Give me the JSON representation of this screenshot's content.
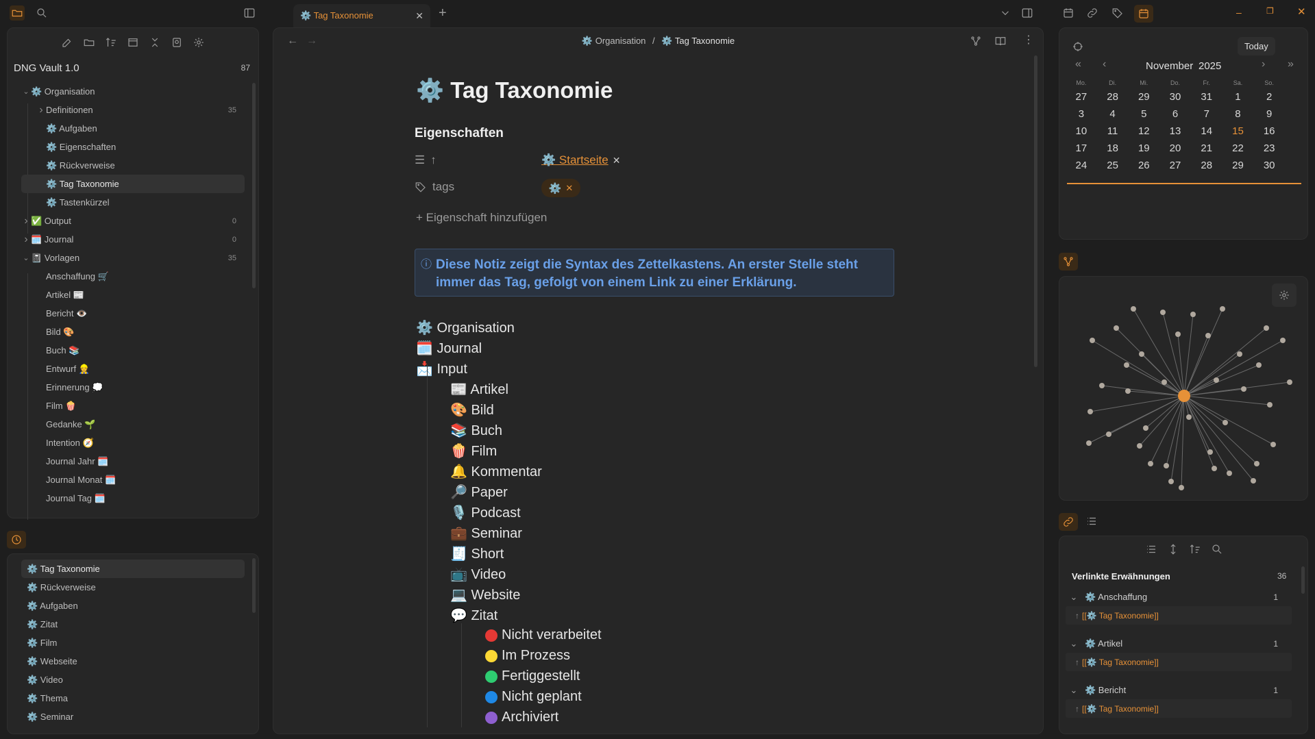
{
  "tab": {
    "title": "⚙️ Tag Taxonomie"
  },
  "breadcrumb": {
    "parent": "⚙️ Organisation",
    "sep": "/",
    "current": "⚙️ Tag Taxonomie"
  },
  "vault": {
    "name": "DNG Vault 1.0",
    "count": "87"
  },
  "tree": [
    {
      "label": "⚙️ Organisation",
      "level": 0,
      "chev": "v",
      "count": ""
    },
    {
      "label": "Definitionen",
      "level": 1,
      "chev": ">",
      "count": "35"
    },
    {
      "label": "⚙️ Aufgaben",
      "level": 1,
      "chev": "",
      "count": ""
    },
    {
      "label": "⚙️ Eigenschaften",
      "level": 1,
      "chev": "",
      "count": ""
    },
    {
      "label": "⚙️ Rückverweise",
      "level": 1,
      "chev": "",
      "count": ""
    },
    {
      "label": "⚙️ Tag Taxonomie",
      "level": 1,
      "chev": "",
      "count": "",
      "active": true
    },
    {
      "label": "⚙️ Tastenkürzel",
      "level": 1,
      "chev": "",
      "count": ""
    },
    {
      "label": "✅ Output",
      "level": 0,
      "chev": ">",
      "count": "0"
    },
    {
      "label": "🗓️ Journal",
      "level": 0,
      "chev": ">",
      "count": "0"
    },
    {
      "label": "📓 Vorlagen",
      "level": 0,
      "chev": "v",
      "count": "35"
    },
    {
      "label": "Anschaffung 🛒",
      "level": 1,
      "chev": "",
      "count": ""
    },
    {
      "label": "Artikel 📰",
      "level": 1,
      "chev": "",
      "count": ""
    },
    {
      "label": "Bericht 👁️",
      "level": 1,
      "chev": "",
      "count": ""
    },
    {
      "label": "Bild 🎨",
      "level": 1,
      "chev": "",
      "count": ""
    },
    {
      "label": "Buch 📚",
      "level": 1,
      "chev": "",
      "count": ""
    },
    {
      "label": "Entwurf 👷",
      "level": 1,
      "chev": "",
      "count": ""
    },
    {
      "label": "Erinnerung 💭",
      "level": 1,
      "chev": "",
      "count": ""
    },
    {
      "label": "Film 🍿",
      "level": 1,
      "chev": "",
      "count": ""
    },
    {
      "label": "Gedanke 🌱",
      "level": 1,
      "chev": "",
      "count": ""
    },
    {
      "label": "Intention 🧭",
      "level": 1,
      "chev": "",
      "count": ""
    },
    {
      "label": "Journal Jahr 🗓️",
      "level": 1,
      "chev": "",
      "count": ""
    },
    {
      "label": "Journal Monat 🗓️",
      "level": 1,
      "chev": "",
      "count": ""
    },
    {
      "label": "Journal Tag 🗓️",
      "level": 1,
      "chev": "",
      "count": ""
    }
  ],
  "recent": [
    "⚙️ Tag Taxonomie",
    "⚙️ Rückverweise",
    "⚙️ Aufgaben",
    "⚙️ Zitat",
    "⚙️ Film",
    "⚙️ Webseite",
    "⚙️ Video",
    "⚙️ Thema",
    "⚙️ Seminar"
  ],
  "note": {
    "title": "⚙️ Tag Taxonomie",
    "props_heading": "Eigenschaften",
    "prop_up_key": "↑",
    "prop_up_value": "⚙️ Startseite",
    "prop_tags_key": "tags",
    "prop_tags_value": "⚙️",
    "add_prop": "+ Eigenschaft hinzufügen",
    "callout": "Diese Notiz zeigt die Syntax des Zettelkastens. An erster Stelle steht immer das Tag, gefolgt von einem Link zu einer Erklärung.",
    "list0": [
      "⚙️ Organisation",
      "🗓️ Journal",
      "📩 Input"
    ],
    "list1": [
      "📰 Artikel",
      "🎨 Bild",
      "📚 Buch",
      "🍿 Film",
      "🔔 Kommentar",
      "🔎 Paper",
      "🎙️ Podcast",
      "💼 Seminar",
      "🧾 Short",
      "📺 Video",
      "💻 Website",
      "💬 Zitat"
    ],
    "list2": [
      "Nicht verarbeitet",
      "Im Prozess",
      "Fertiggestellt",
      "Nicht geplant",
      "Archiviert"
    ],
    "list2_colors": [
      "#e53935",
      "#fdd835",
      "#2ecc71",
      "#1e88e5",
      "#8e5fd0"
    ]
  },
  "calendar": {
    "month": "November",
    "year": "2025",
    "today": "Today",
    "weekdays": [
      "Mo.",
      "Di.",
      "Mi.",
      "Do.",
      "Fr.",
      "Sa.",
      "So."
    ],
    "weeks": [
      [
        "27",
        "28",
        "29",
        "30",
        "31",
        "1",
        "2"
      ],
      [
        "3",
        "4",
        "5",
        "6",
        "7",
        "8",
        "9"
      ],
      [
        "10",
        "11",
        "12",
        "13",
        "14",
        "15",
        "16"
      ],
      [
        "17",
        "18",
        "19",
        "20",
        "21",
        "22",
        "23"
      ],
      [
        "24",
        "25",
        "26",
        "27",
        "28",
        "29",
        "30"
      ]
    ],
    "highlight": "15"
  },
  "backlinks": {
    "title": "Verlinkte Erwähnungen",
    "count": "36",
    "groups": [
      {
        "name": "⚙️ Anschaffung",
        "count": "1",
        "link": "[[⚙️ Tag Taxonomie]]"
      },
      {
        "name": "⚙️ Artikel",
        "count": "1",
        "link": "[[⚙️ Tag Taxonomie]]"
      },
      {
        "name": "⚙️ Bericht",
        "count": "1",
        "link": "[[⚙️ Tag Taxonomie]]"
      }
    ]
  },
  "colors": {
    "accent": "#e69138",
    "bg": "#1e1e1e",
    "panel": "#262626"
  }
}
